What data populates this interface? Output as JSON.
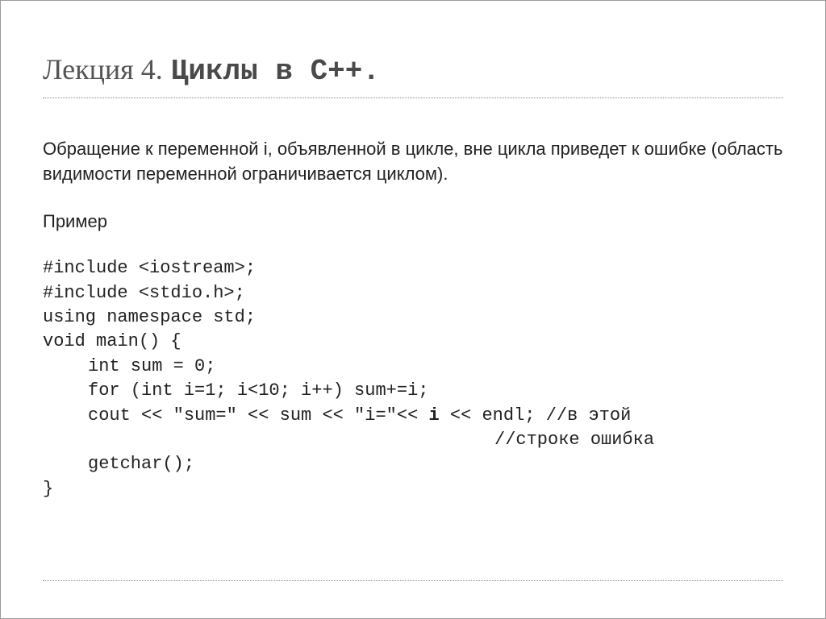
{
  "title": {
    "light": "Лекция 4.",
    "bold": "Циклы в C++."
  },
  "paragraph": "Обращение к переменной i, объявленной в цикле, вне цикла приведет к ошибке (область видимости переменной ограничивается циклом).",
  "example_label": "Пример",
  "code": {
    "l1": "#include <iostream>;",
    "l2": "#include <stdio.h>;",
    "l3": "using namespace std;",
    "l4": "void main() {",
    "l5": "int sum = 0;",
    "l6": "for (int i=1; i<10; i++) sum+=i;",
    "l7a": "cout << \"sum=\" << sum << \"i=\"<< ",
    "l7b": "i",
    "l7c": " << endl; //в этой",
    "l8": "//строке ошибка",
    "l9": "getchar();",
    "l10": "}"
  }
}
